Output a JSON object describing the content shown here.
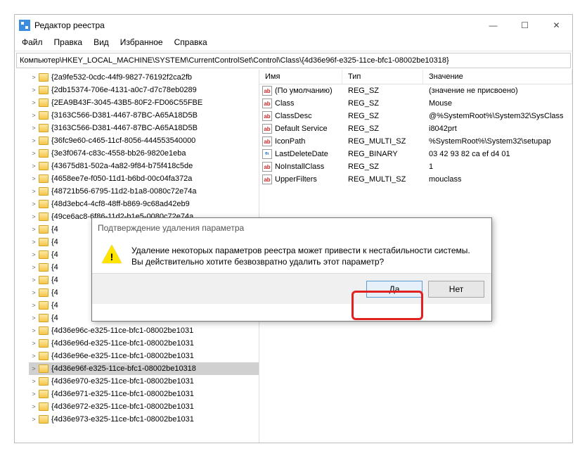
{
  "title": "Редактор реестра",
  "menu": [
    "Файл",
    "Правка",
    "Вид",
    "Избранное",
    "Справка"
  ],
  "address": "Компьютер\\HKEY_LOCAL_MACHINE\\SYSTEM\\CurrentControlSet\\Control\\Class\\{4d36e96f-e325-11ce-bfc1-08002be10318}",
  "tree": [
    "{2a9fe532-0cdc-44f9-9827-76192f2ca2fb",
    "{2db15374-706e-4131-a0c7-d7c78eb0289",
    "{2EA9B43F-3045-43B5-80F2-FD06C55FBE",
    "{3163C566-D381-4467-87BC-A65A18D5B",
    "{3163C566-D381-4467-87BC-A65A18D5B",
    "{36fc9e60-c465-11cf-8056-444553540000",
    "{3e3f0674-c83c-4558-bb26-9820e1eba",
    "{43675d81-502a-4a82-9f84-b75f418c5de",
    "{4658ee7e-f050-11d1-b6bd-00c04fa372a",
    "{48721b56-6795-11d2-b1a8-0080c72e74a",
    "{48d3ebc4-4cf8-48ff-b869-9c68ad42eb9",
    "{49ce6ac8-6f86-11d2-b1e5-0080c72e74a",
    "{4",
    "{4",
    "{4",
    "{4",
    "{4",
    "{4",
    "{4",
    "{4",
    "{4d36e96c-e325-11ce-bfc1-08002be1031",
    "{4d36e96d-e325-11ce-bfc1-08002be1031",
    "{4d36e96e-e325-11ce-bfc1-08002be1031",
    "{4d36e96f-e325-11ce-bfc1-08002be10318",
    "{4d36e970-e325-11ce-bfc1-08002be1031",
    "{4d36e971-e325-11ce-bfc1-08002be1031",
    "{4d36e972-e325-11ce-bfc1-08002be1031",
    "{4d36e973-e325-11ce-bfc1-08002be1031"
  ],
  "selected_index": 23,
  "list_headers": {
    "name": "Имя",
    "type": "Тип",
    "value": "Значение"
  },
  "values": [
    {
      "icon": "str",
      "name": "(По умолчанию)",
      "type": "REG_SZ",
      "value": "(значение не присвоено)"
    },
    {
      "icon": "str",
      "name": "Class",
      "type": "REG_SZ",
      "value": "Mouse"
    },
    {
      "icon": "str",
      "name": "ClassDesc",
      "type": "REG_SZ",
      "value": "@%SystemRoot%\\System32\\SysClass"
    },
    {
      "icon": "str",
      "name": "Default Service",
      "type": "REG_SZ",
      "value": "i8042prt"
    },
    {
      "icon": "str",
      "name": "IconPath",
      "type": "REG_MULTI_SZ",
      "value": "%SystemRoot%\\System32\\setupap"
    },
    {
      "icon": "bin",
      "name": "LastDeleteDate",
      "type": "REG_BINARY",
      "value": "03 42 93 82 ca ef d4 01"
    },
    {
      "icon": "str",
      "name": "NoInstallClass",
      "type": "REG_SZ",
      "value": "1"
    },
    {
      "icon": "str",
      "name": "UpperFilters",
      "type": "REG_MULTI_SZ",
      "value": "mouclass"
    }
  ],
  "dialog": {
    "title": "Подтверждение удаления параметра",
    "line1": "Удаление некоторых параметров реестра может привести к нестабильности системы.",
    "line2": "Вы действительно хотите безвозвратно удалить этот параметр?",
    "yes": "Да",
    "no": "Нет"
  },
  "win_controls": {
    "min": "—",
    "max": "☐",
    "close": "✕"
  }
}
